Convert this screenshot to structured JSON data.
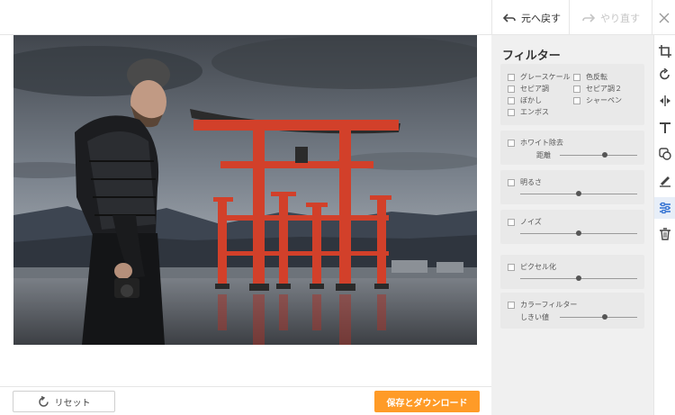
{
  "toolbar": {
    "undo_label": "元へ戻す",
    "redo_label": "やり直す"
  },
  "panel": {
    "title": "フィルター",
    "group1": {
      "grayscale": "グレースケール",
      "invert": "色反転",
      "sepia": "セピア調",
      "sepia2": "セピア調２",
      "blur": "ぼかし",
      "sharpen": "シャーペン",
      "emboss": "エンボス"
    },
    "whiteremove": {
      "label": "ホワイト除去",
      "sub": "距離",
      "value": 0.58
    },
    "brightness": {
      "label": "明るさ",
      "value": 0.5
    },
    "noise": {
      "label": "ノイズ",
      "value": 0.5
    },
    "pixelate": {
      "label": "ピクセル化",
      "value": 0.5
    },
    "colorfilter": {
      "label": "カラーフィルター",
      "sub": "しきい値",
      "value": 0.58
    }
  },
  "bottom": {
    "reset_label": "リセット",
    "save_label": "保存とダウンロード"
  },
  "colors": {
    "accent": "#ff9b27",
    "panel_bg": "#f0f0f0",
    "active_tool": "#2f6fd1"
  },
  "tools": [
    "crop-icon",
    "rotate-icon",
    "flip-icon",
    "text-icon",
    "shape-icon",
    "draw-icon",
    "filter-icon",
    "delete-icon"
  ]
}
